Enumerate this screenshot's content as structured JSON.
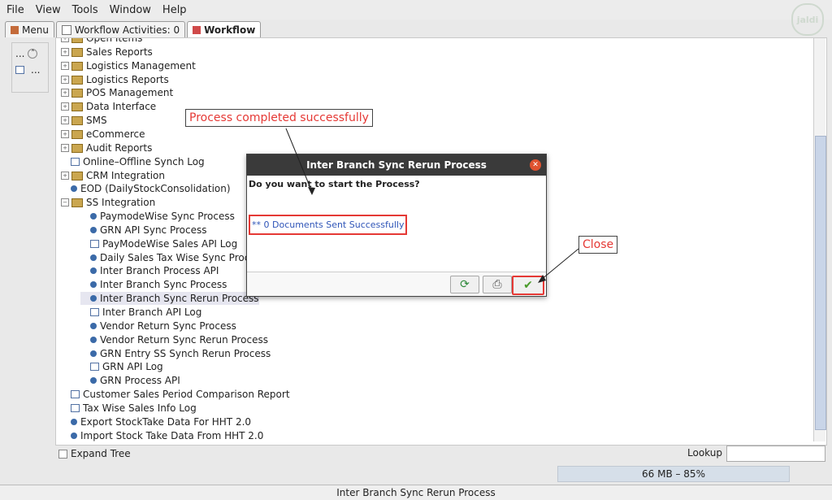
{
  "menubar": {
    "file": "File",
    "view": "View",
    "tools": "Tools",
    "window": "Window",
    "help": "Help"
  },
  "logo": "jaldi",
  "tabs": [
    {
      "label": "Menu"
    },
    {
      "label": "Workflow Activities: 0"
    },
    {
      "label": "Workflow"
    }
  ],
  "left_panel": {
    "item1": "...",
    "item2": "..."
  },
  "tree": {
    "items": [
      {
        "label": "Open Items",
        "type": "folder",
        "level": 0
      },
      {
        "label": "Sales Reports",
        "type": "folder",
        "level": 0
      },
      {
        "label": "Logistics Management",
        "type": "folder",
        "level": 0
      },
      {
        "label": "Logistics Reports",
        "type": "folder",
        "level": 0
      },
      {
        "label": "POS Management",
        "type": "folder",
        "level": 0
      },
      {
        "label": "Data Interface",
        "type": "folder",
        "level": 0
      },
      {
        "label": "SMS",
        "type": "folder",
        "level": 0
      },
      {
        "label": "eCommerce",
        "type": "folder",
        "level": 0
      },
      {
        "label": "Audit Reports",
        "type": "folder",
        "level": 0
      },
      {
        "label": "Online–Offline Synch Log",
        "type": "doc",
        "level": 0
      },
      {
        "label": "CRM Integration",
        "type": "folder",
        "level": 0
      },
      {
        "label": "EOD (DailyStockConsolidation)",
        "type": "gear",
        "level": 0
      },
      {
        "label": "SS Integration",
        "type": "folder-open",
        "level": 0
      },
      {
        "label": "PaymodeWise Sync Process",
        "type": "gear",
        "level": 1
      },
      {
        "label": "GRN API Sync Process",
        "type": "gear",
        "level": 1
      },
      {
        "label": "PayModeWise Sales API Log",
        "type": "doc",
        "level": 1
      },
      {
        "label": "Daily Sales Tax Wise Sync Proce",
        "type": "gear",
        "level": 1
      },
      {
        "label": "Inter Branch Process API",
        "type": "gear",
        "level": 1
      },
      {
        "label": "Inter Branch Sync Process",
        "type": "gear",
        "level": 1
      },
      {
        "label": "Inter Branch Sync Rerun Process",
        "type": "gear",
        "level": 1,
        "selected": true
      },
      {
        "label": "Inter Branch API Log",
        "type": "doc",
        "level": 1
      },
      {
        "label": "Vendor Return Sync Process",
        "type": "gear",
        "level": 1
      },
      {
        "label": "Vendor Return Sync Rerun Process",
        "type": "gear",
        "level": 1
      },
      {
        "label": "GRN Entry SS Synch Rerun Process",
        "type": "gear",
        "level": 1
      },
      {
        "label": "GRN API Log",
        "type": "doc",
        "level": 1
      },
      {
        "label": "GRN Process API",
        "type": "gear",
        "level": 1
      },
      {
        "label": "Customer Sales Period Comparison Report",
        "type": "doc",
        "level": 0
      },
      {
        "label": "Tax Wise Sales Info Log",
        "type": "doc",
        "level": 0
      },
      {
        "label": "Export StockTake Data For HHT 2.0",
        "type": "gear",
        "level": 0
      },
      {
        "label": "Import Stock Take Data From HHT 2.0",
        "type": "gear",
        "level": 0
      }
    ]
  },
  "bottom": {
    "expand_tree": "Expand Tree",
    "lookup": "Lookup"
  },
  "memory": "66 MB – 85%",
  "status": "Inter Branch Sync Rerun Process",
  "dialog": {
    "title": "Inter Branch Sync Rerun Process",
    "question": "Do you want to start the Process?",
    "message": "** 0 Documents Sent Successfully"
  },
  "annotations": {
    "process_completed": "Process completed successfully",
    "close": "Close"
  }
}
